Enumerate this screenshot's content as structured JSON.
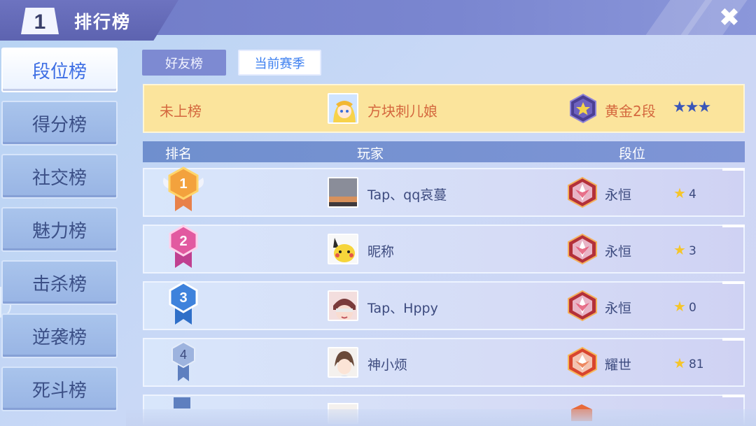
{
  "header": {
    "rank_number": "1",
    "title": "排行榜",
    "close_label": "✖"
  },
  "sidebar": {
    "items": [
      {
        "label": "段位榜",
        "active": true
      },
      {
        "label": "得分榜",
        "active": false
      },
      {
        "label": "社交榜",
        "active": false
      },
      {
        "label": "魅力榜",
        "active": false
      },
      {
        "label": "击杀榜",
        "active": false
      },
      {
        "label": "逆袭榜",
        "active": false
      },
      {
        "label": "死斗榜",
        "active": false
      }
    ]
  },
  "tabs": [
    {
      "label": "好友榜",
      "active": false
    },
    {
      "label": "当前赛季",
      "active": true
    }
  ],
  "my_rank": {
    "rank": "未上榜",
    "player": "方块刺儿娘",
    "tier": "黄金2段",
    "stars": "★★★"
  },
  "columns": {
    "rank": "排名",
    "player": "玩家",
    "tier": "段位"
  },
  "rows": [
    {
      "rank": "1",
      "player": "Tap、qq哀蔓",
      "tier": "永恒",
      "star_icon": "★",
      "stars": "4"
    },
    {
      "rank": "2",
      "player": "昵称",
      "tier": "永恒",
      "star_icon": "★",
      "stars": "3"
    },
    {
      "rank": "3",
      "player": "Tap、Hppy",
      "tier": "永恒",
      "star_icon": "★",
      "stars": "0"
    },
    {
      "rank": "4",
      "player": "神小烦",
      "tier": "耀世",
      "star_icon": "★",
      "stars": "81"
    }
  ],
  "colors": {
    "accent": "#3d6ee4",
    "highlight_row": "#fbe49c",
    "gold_medal": "#f39a3a",
    "silver_medal": "#e0559a",
    "bronze_medal": "#3d7cd8",
    "star": "#f5c52a"
  }
}
